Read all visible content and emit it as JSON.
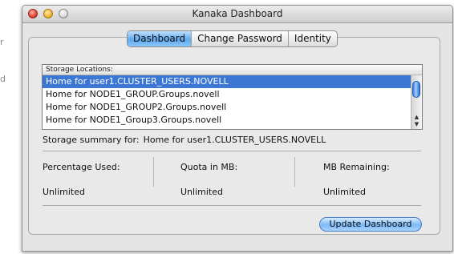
{
  "background": {
    "left_fragment_1": "r",
    "left_fragment_2": "d"
  },
  "window": {
    "title": "Kanaka Dashboard"
  },
  "tabs": [
    {
      "label": "Dashboard",
      "active": true
    },
    {
      "label": "Change Password",
      "active": false
    },
    {
      "label": "Identity",
      "active": false
    }
  ],
  "storage_list": {
    "header": "Storage Locations:",
    "items": [
      "Home for user1.CLUSTER_USERS.NOVELL",
      "Home for NODE1_GROUP.Groups.novell",
      "Home for NODE1_GROUP2.Groups.novell",
      "Home for NODE1_Group3.Groups.novell"
    ],
    "selected_index": 0
  },
  "summary": {
    "label": "Storage summary for:",
    "value": "Home for user1.CLUSTER_USERS.NOVELL"
  },
  "stats": {
    "percentage_used": {
      "label": "Percentage Used:",
      "value": "Unlimited"
    },
    "quota_mb": {
      "label": "Quota in MB:",
      "value": "Unlimited"
    },
    "mb_remaining": {
      "label": "MB Remaining:",
      "value": "Unlimited"
    }
  },
  "buttons": {
    "update_dashboard": "Update Dashboard"
  },
  "colors": {
    "selection": "#3c77d4",
    "accent_blue": "#5ea9ee"
  }
}
